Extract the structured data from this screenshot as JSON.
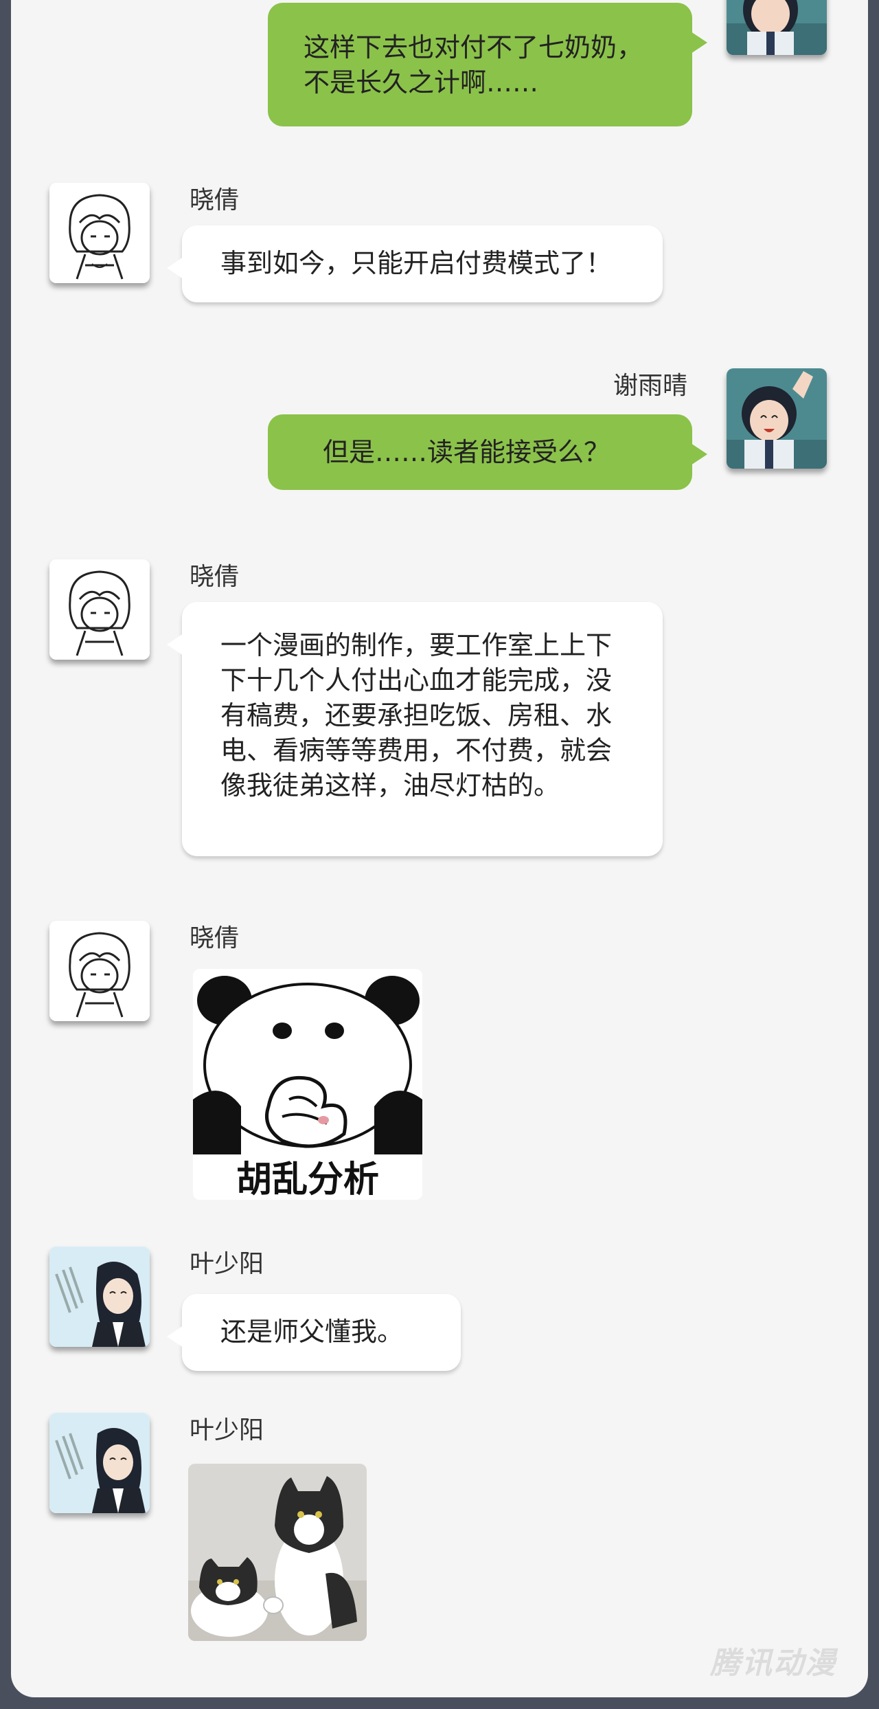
{
  "participants": {
    "xiaoqian": "晓倩",
    "xieyuqing": "谢雨晴",
    "yeshaoyang": "叶少阳"
  },
  "messages": [
    {
      "sender": "",
      "side": "right",
      "text": "这样下去也对付不了七奶奶，不是长久之计啊……"
    },
    {
      "sender": "晓倩",
      "side": "left",
      "text": "事到如今，只能开启付费模式了！"
    },
    {
      "sender": "谢雨晴",
      "side": "right",
      "text": "但是……读者能接受么？"
    },
    {
      "sender": "晓倩",
      "side": "left",
      "text": "一个漫画的制作，要工作室上上下下十几个人付出心血才能完成，没有稿费，还要承担吃饭、房租、水电、看病等等费用，不付费，就会像我徒弟这样，油尽灯枯的。"
    },
    {
      "sender": "晓倩",
      "side": "left",
      "sticker": "panda-meme",
      "sticker_caption": "胡乱分析"
    },
    {
      "sender": "叶少阳",
      "side": "left",
      "text": "还是师父懂我。"
    },
    {
      "sender": "叶少阳",
      "side": "left",
      "sticker": "cats-thumbs-up"
    }
  ],
  "watermark": "腾讯动漫",
  "colors": {
    "background": "#f5f5f5",
    "border": "#4a4f5e",
    "bubble_right": "#8bc24a",
    "bubble_left": "#ffffff"
  },
  "icons": {
    "xiaoqian_avatar": "sketch-girl-avatar",
    "xieyuqing_avatar": "anime-girl-waving-avatar",
    "yeshaoyang_avatar": "anime-boy-avatar"
  }
}
